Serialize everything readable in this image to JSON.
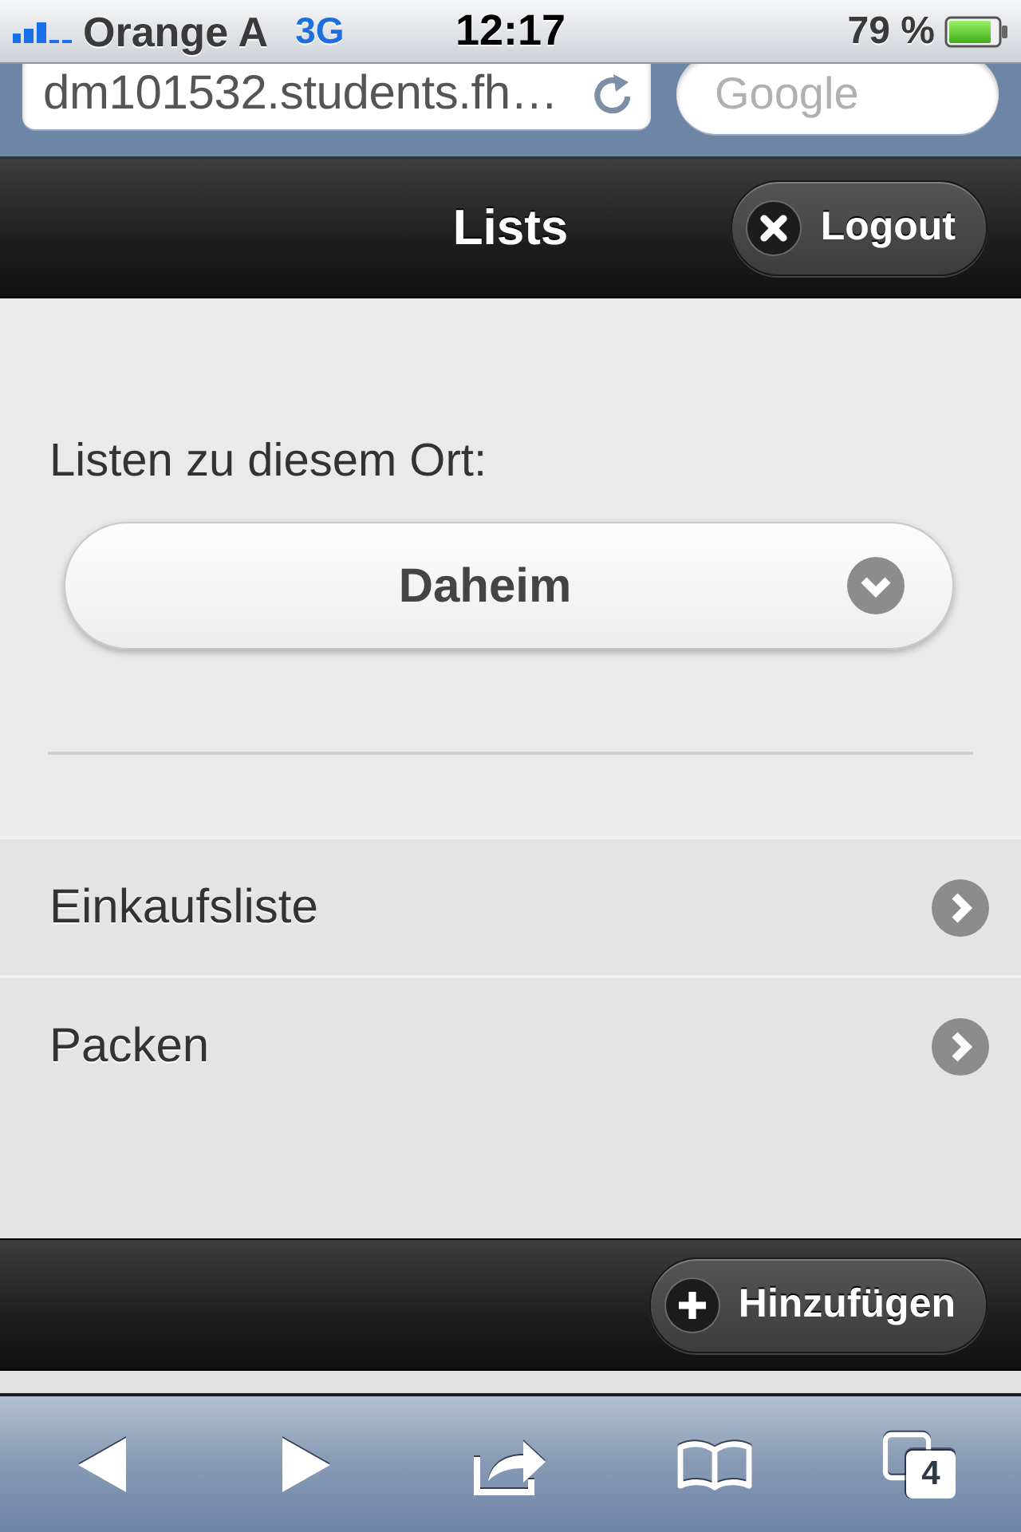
{
  "status_bar": {
    "carrier": "Orange A",
    "network": "3G",
    "time": "12:17",
    "battery_text": "79 %"
  },
  "browser_bar": {
    "url": "dm101532.students.fh…",
    "search_placeholder": "Google"
  },
  "header": {
    "title": "Lists",
    "logout_button": "Logout"
  },
  "location": {
    "label": "Listen zu diesem Ort:",
    "value": "Daheim"
  },
  "lists": [
    {
      "label": "Einkaufsliste"
    },
    {
      "label": "Packen"
    }
  ],
  "footer": {
    "add_button": "Hinzufügen"
  },
  "browser_toolbar": {
    "tab_count": "4"
  }
}
